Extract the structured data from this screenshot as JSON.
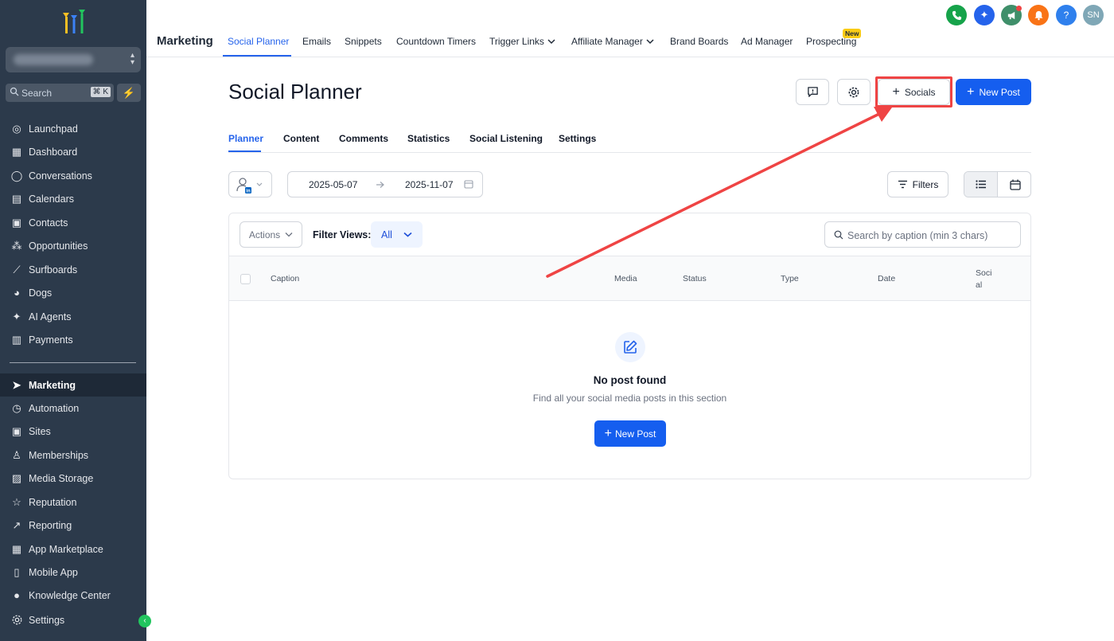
{
  "sidebar": {
    "search_placeholder": "Search",
    "search_shortcut": "⌘ K",
    "items": [
      {
        "label": "Launchpad",
        "icon": "launchpad-icon"
      },
      {
        "label": "Dashboard",
        "icon": "dashboard-icon"
      },
      {
        "label": "Conversations",
        "icon": "chat-icon"
      },
      {
        "label": "Calendars",
        "icon": "calendar-icon"
      },
      {
        "label": "Contacts",
        "icon": "contacts-icon"
      },
      {
        "label": "Opportunities",
        "icon": "opportunities-icon"
      },
      {
        "label": "Surfboards",
        "icon": "surfboard-icon"
      },
      {
        "label": "Dogs",
        "icon": "dog-icon"
      },
      {
        "label": "AI Agents",
        "icon": "sparkle-icon"
      },
      {
        "label": "Payments",
        "icon": "payments-icon"
      },
      {
        "label": "Marketing",
        "icon": "send-icon"
      },
      {
        "label": "Automation",
        "icon": "automation-icon"
      },
      {
        "label": "Sites",
        "icon": "sites-icon"
      },
      {
        "label": "Memberships",
        "icon": "memberships-icon"
      },
      {
        "label": "Media Storage",
        "icon": "image-icon"
      },
      {
        "label": "Reputation",
        "icon": "star-icon"
      },
      {
        "label": "Reporting",
        "icon": "trend-icon"
      },
      {
        "label": "App Marketplace",
        "icon": "grid-icon"
      },
      {
        "label": "Mobile App",
        "icon": "phone-icon"
      },
      {
        "label": "Knowledge Center",
        "icon": "info-icon"
      }
    ],
    "active": "Marketing",
    "settings_label": "Settings"
  },
  "topbar": {
    "title": "Marketing",
    "tabs": [
      {
        "label": "Social Planner"
      },
      {
        "label": "Emails"
      },
      {
        "label": "Snippets"
      },
      {
        "label": "Countdown Timers"
      },
      {
        "label": "Trigger Links"
      },
      {
        "label": "Affiliate Manager"
      },
      {
        "label": "Brand Boards"
      },
      {
        "label": "Ad Manager"
      },
      {
        "label": "Prospecting"
      }
    ],
    "new_badge": "New",
    "avatar_initials": "SN",
    "help_glyph": "?"
  },
  "page": {
    "title": "Social Planner",
    "socials_label": "Socials",
    "new_post_label": "New Post",
    "subtabs": [
      {
        "label": "Planner"
      },
      {
        "label": "Content"
      },
      {
        "label": "Comments"
      },
      {
        "label": "Statistics"
      },
      {
        "label": "Social Listening"
      },
      {
        "label": "Settings"
      }
    ],
    "date_start": "2025-05-07",
    "date_end": "2025-11-07",
    "filters_label": "Filters",
    "actions_label": "Actions",
    "filter_views_label": "Filter Views:",
    "filter_views_value": "All",
    "search_placeholder": "Search by caption (min 3 chars)",
    "columns": {
      "caption": "Caption",
      "media": "Media",
      "status": "Status",
      "type": "Type",
      "date": "Date",
      "social_line1": "Soci",
      "social_line2": "al"
    },
    "empty_title": "No post found",
    "empty_subtitle": "Find all your social media posts in this section",
    "empty_button": "New Post"
  },
  "colors": {
    "primary": "#155eef",
    "sidebar_bg": "#2c3a4b",
    "highlight": "#ef4444"
  }
}
